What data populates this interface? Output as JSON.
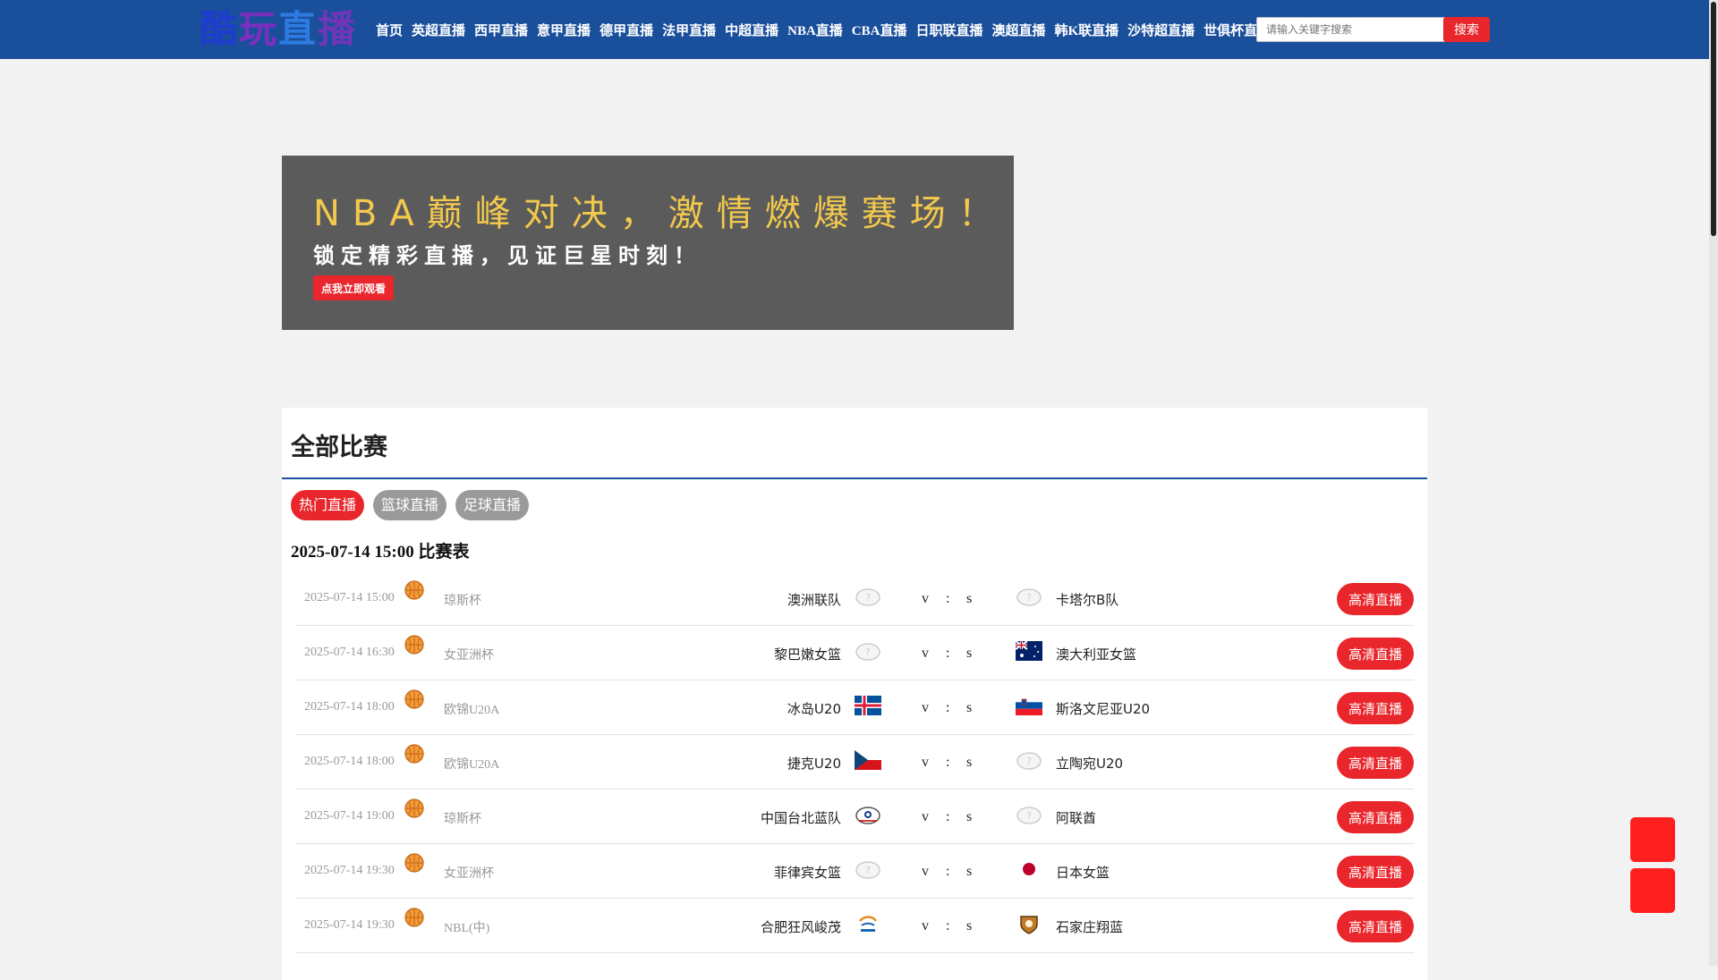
{
  "header": {
    "logo_chars": [
      "酷",
      "玩",
      "直",
      "播"
    ],
    "logo_colors": [
      "#1e3ccf",
      "#7b2fbe",
      "#2d7be0",
      "#6f36b8"
    ],
    "nav": [
      "首页",
      "英超直播",
      "西甲直播",
      "意甲直播",
      "德甲直播",
      "法甲直播",
      "中超直播",
      "NBA直播",
      "CBA直播",
      "日职联直播",
      "澳超直播",
      "韩K联直播",
      "沙特超直播",
      "世俱杯直播"
    ],
    "search_placeholder": "请输入关键字搜索",
    "search_button": "搜索"
  },
  "banner": {
    "headline": "NBA巅峰对决，激情燃爆赛场！",
    "subline": "锁定精彩直播，见证巨星时刻！",
    "cta": "点我立即观看"
  },
  "section": {
    "title": "全部比赛",
    "tabs": [
      "热门直播",
      "篮球直播",
      "足球直播"
    ],
    "active_tab": 0,
    "date_heading": "2025-07-14 15:00 比赛表"
  },
  "matches": [
    {
      "time": "2025-07-14 15:00",
      "league": "琼斯杯",
      "home": "澳洲联队",
      "home_icon": "placeholder-logo",
      "v": "v",
      "colon": ":",
      "s": "s",
      "away": "卡塔尔B队",
      "away_icon": "placeholder-logo",
      "action": "高清直播"
    },
    {
      "time": "2025-07-14 16:30",
      "league": "女亚洲杯",
      "home": "黎巴嫩女篮",
      "home_icon": "placeholder-logo",
      "v": "v",
      "colon": ":",
      "s": "s",
      "away": "澳大利亚女篮",
      "away_icon": "australia-flag",
      "action": "高清直播"
    },
    {
      "time": "2025-07-14 18:00",
      "league": "欧锦U20A",
      "home": "冰岛U20",
      "home_icon": "iceland-flag",
      "v": "v",
      "colon": ":",
      "s": "s",
      "away": "斯洛文尼亚U20",
      "away_icon": "slovenia-flag",
      "action": "高清直播"
    },
    {
      "time": "2025-07-14 18:00",
      "league": "欧锦U20A",
      "home": "捷克U20",
      "home_icon": "czech-flag",
      "v": "v",
      "colon": ":",
      "s": "s",
      "away": "立陶宛U20",
      "away_icon": "placeholder-logo",
      "action": "高清直播"
    },
    {
      "time": "2025-07-14 19:00",
      "league": "琼斯杯",
      "home": "中国台北蓝队",
      "home_icon": "chinese-taipei-logo",
      "v": "v",
      "colon": ":",
      "s": "s",
      "away": "阿联酋",
      "away_icon": "placeholder-logo",
      "action": "高清直播"
    },
    {
      "time": "2025-07-14 19:30",
      "league": "女亚洲杯",
      "home": "菲律宾女篮",
      "home_icon": "placeholder-logo",
      "v": "v",
      "colon": ":",
      "s": "s",
      "away": "日本女篮",
      "away_icon": "japan-flag",
      "action": "高清直播"
    },
    {
      "time": "2025-07-14 19:30",
      "league": "NBL(中)",
      "home": "合肥狂风峻茂",
      "home_icon": "hefei-team-logo",
      "v": "v",
      "colon": ":",
      "s": "s",
      "away": "石家庄翔蓝",
      "away_icon": "shijiazhuang-team-logo",
      "action": "高清直播"
    }
  ],
  "colors": {
    "nav_bg": "#1a4f9c",
    "accent_red": "#e8262b",
    "banner_bg": "#5b5b5b",
    "banner_headline": "#f2c94c"
  }
}
